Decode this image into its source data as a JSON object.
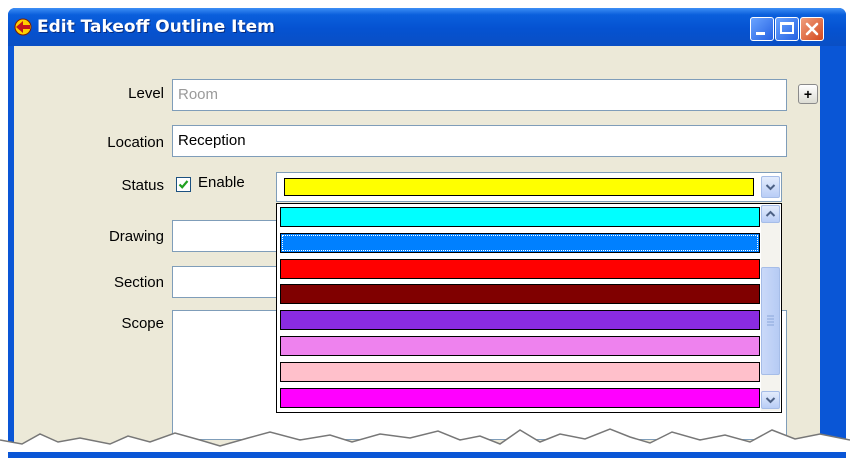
{
  "window": {
    "title": "Edit Takeoff Outline Item"
  },
  "form": {
    "level_label": "Level",
    "level_value": "Room",
    "level_add": "+",
    "location_label": "Location",
    "location_value": "Reception",
    "status_label": "Status",
    "enable_label": "Enable",
    "enable_checked": true,
    "status_color": "#ffff00",
    "drawing_label": "Drawing",
    "drawing_value": "",
    "section_label": "Section",
    "section_value": "",
    "scope_label": "Scope",
    "scope_value": ""
  },
  "color_options": [
    {
      "color": "#00ffff",
      "selected": false
    },
    {
      "color": "#0080ff",
      "selected": true
    },
    {
      "color": "#ff0000",
      "selected": false
    },
    {
      "color": "#800000",
      "selected": false
    },
    {
      "color": "#8a2be2",
      "selected": false
    },
    {
      "color": "#ee82ee",
      "selected": false
    },
    {
      "color": "#ffc0cb",
      "selected": false
    },
    {
      "color": "#ff00ff",
      "selected": false
    }
  ]
}
